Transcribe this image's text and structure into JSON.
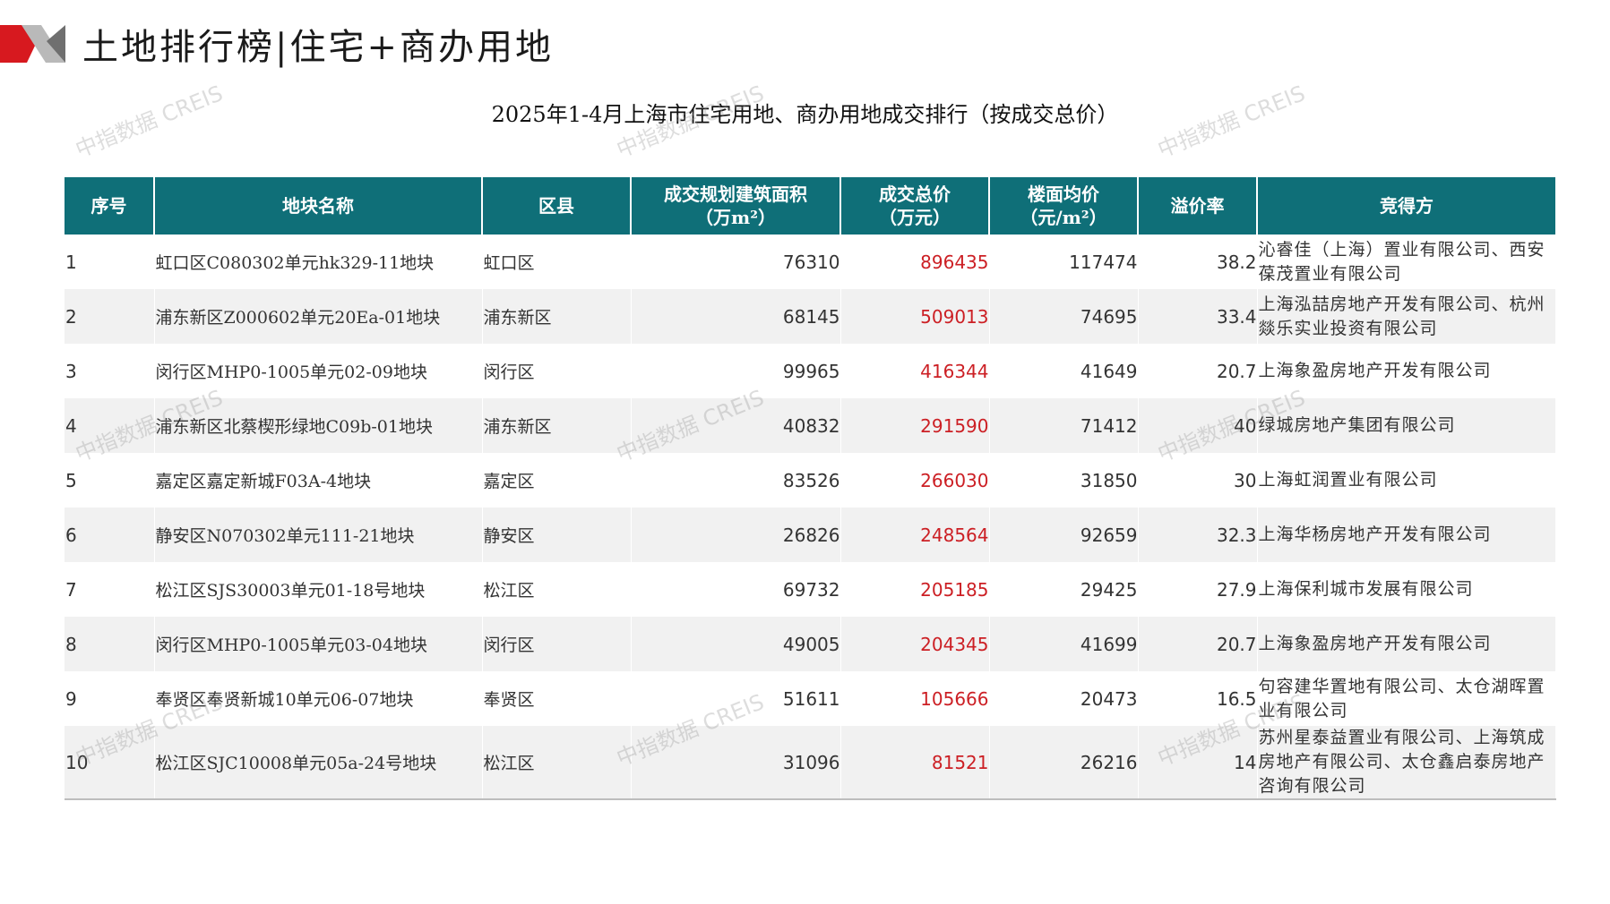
{
  "page": {
    "title": "土地排行榜|住宅+商办用地",
    "caption": "2025年1-4月上海市住宅用地、商办用地成交排行（按成交总价）",
    "watermark": "中指数据 CREIS"
  },
  "colors": {
    "header_bg": "#0f6f78",
    "accent_red": "#cc1f24",
    "logo_red": "#d7191f"
  },
  "table": {
    "headers": {
      "rank": "序号",
      "name": "地块名称",
      "district": "区县",
      "area_1": "成交规划建筑面积",
      "area_2": "（万m²）",
      "total_1": "成交总价",
      "total_2": "（万元）",
      "unit_1": "楼面均价",
      "unit_2": "（元/m²）",
      "premium": "溢价率",
      "buyer": "竞得方"
    },
    "rows": [
      {
        "rank": "1",
        "name": "虹口区C080302单元hk329-11地块",
        "district": "虹口区",
        "area": "76310",
        "total": "896435",
        "unit_price": "117474",
        "premium": "38.2",
        "buyer": "沁睿佳（上海）置业有限公司、西安葆茂置业有限公司"
      },
      {
        "rank": "2",
        "name": "浦东新区Z000602单元20Ea-01地块",
        "district": "浦东新区",
        "area": "68145",
        "total": "509013",
        "unit_price": "74695",
        "premium": "33.4",
        "buyer": "上海泓喆房地产开发有限公司、杭州燚乐实业投资有限公司"
      },
      {
        "rank": "3",
        "name": "闵行区MHP0-1005单元02-09地块",
        "district": "闵行区",
        "area": "99965",
        "total": "416344",
        "unit_price": "41649",
        "premium": "20.7",
        "buyer": "上海象盈房地产开发有限公司"
      },
      {
        "rank": "4",
        "name": "浦东新区北蔡楔形绿地C09b-01地块",
        "district": "浦东新区",
        "area": "40832",
        "total": "291590",
        "unit_price": "71412",
        "premium": "40",
        "buyer": "绿城房地产集团有限公司"
      },
      {
        "rank": "5",
        "name": "嘉定区嘉定新城F03A-4地块",
        "district": "嘉定区",
        "area": "83526",
        "total": "266030",
        "unit_price": "31850",
        "premium": "30",
        "buyer": "上海虹润置业有限公司"
      },
      {
        "rank": "6",
        "name": "静安区N070302单元111-21地块",
        "district": "静安区",
        "area": "26826",
        "total": "248564",
        "unit_price": "92659",
        "premium": "32.3",
        "buyer": "上海华杨房地产开发有限公司"
      },
      {
        "rank": "7",
        "name": "松江区SJS30003单元01-18号地块",
        "district": "松江区",
        "area": "69732",
        "total": "205185",
        "unit_price": "29425",
        "premium": "27.9",
        "buyer": "上海保利城市发展有限公司"
      },
      {
        "rank": "8",
        "name": "闵行区MHP0-1005单元03-04地块",
        "district": "闵行区",
        "area": "49005",
        "total": "204345",
        "unit_price": "41699",
        "premium": "20.7",
        "buyer": "上海象盈房地产开发有限公司"
      },
      {
        "rank": "9",
        "name": "奉贤区奉贤新城10单元06-07地块",
        "district": "奉贤区",
        "area": "51611",
        "total": "105666",
        "unit_price": "20473",
        "premium": "16.5",
        "buyer": "句容建华置地有限公司、太仓湖晖置业有限公司"
      },
      {
        "rank": "10",
        "name": "松江区SJC10008单元05a-24号地块",
        "district": "松江区",
        "area": "31096",
        "total": "81521",
        "unit_price": "26216",
        "premium": "14",
        "buyer": "苏州星泰益置业有限公司、上海筑成房地产有限公司、太仓鑫启泰房地产咨询有限公司"
      }
    ]
  }
}
